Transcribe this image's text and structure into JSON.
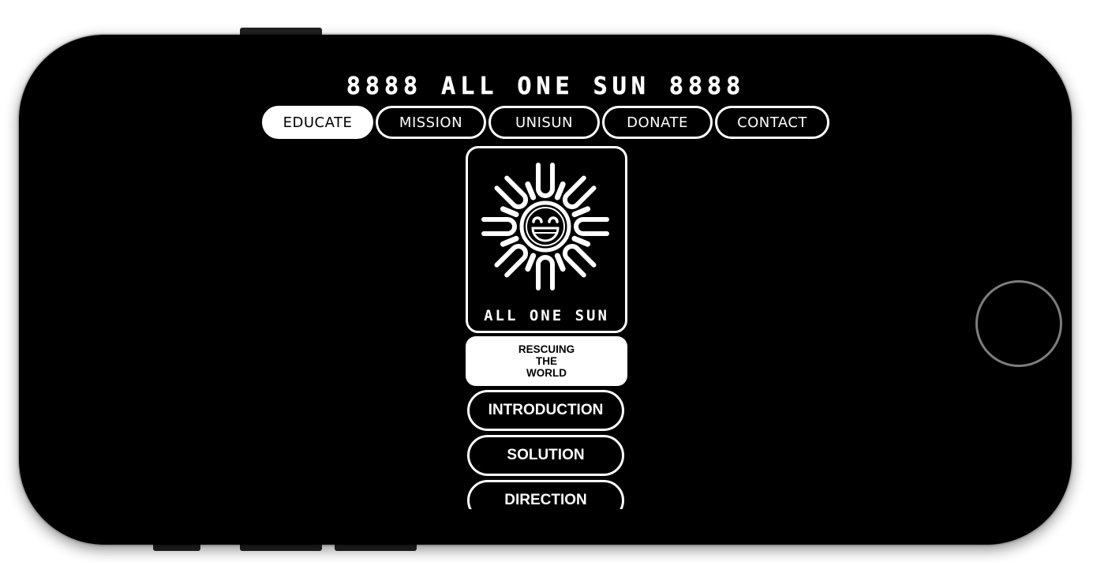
{
  "site": {
    "title": "8888 ALL ONE SUN 8888"
  },
  "nav": {
    "tabs": [
      {
        "label": "EDUCATE",
        "active": true
      },
      {
        "label": "MISSION",
        "active": false
      },
      {
        "label": "UNISUN",
        "active": false
      },
      {
        "label": "DONATE",
        "active": false
      },
      {
        "label": "CONTACT",
        "active": false
      }
    ]
  },
  "logo": {
    "text": "ALL ONE SUN",
    "icon": "smiling-sun-icon"
  },
  "headline": {
    "lines": [
      "RESCUING",
      "THE",
      "WORLD"
    ]
  },
  "menu": {
    "items": [
      {
        "label": "INTRODUCTION"
      },
      {
        "label": "SOLUTION"
      },
      {
        "label": "DIRECTION"
      }
    ]
  },
  "colors": {
    "background": "#000000",
    "foreground": "#ffffff",
    "home_ring": "#7d7d7d"
  }
}
